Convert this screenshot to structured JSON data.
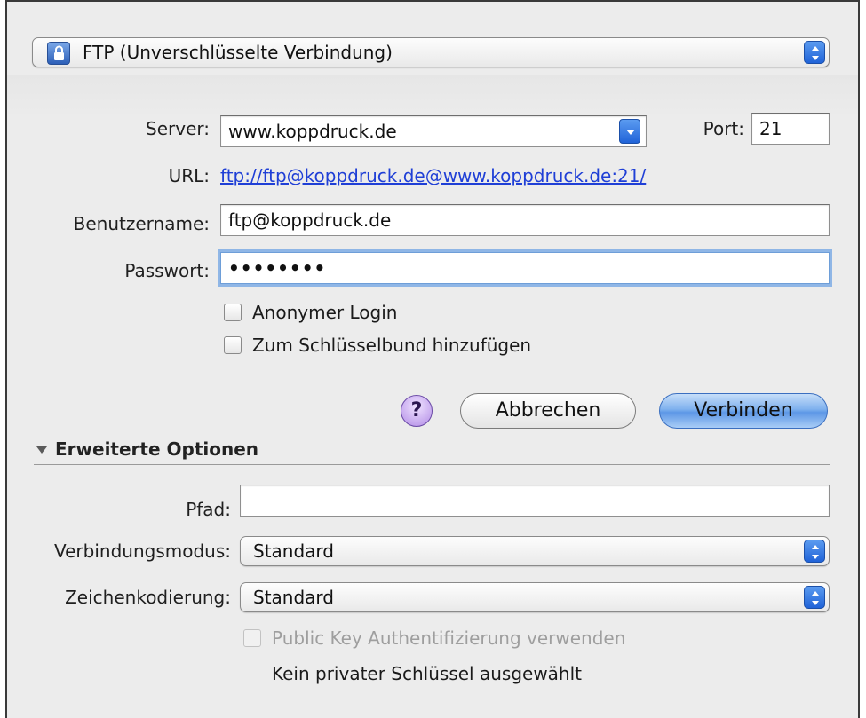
{
  "connection_type": {
    "value": "FTP (Unverschlüsselte Verbindung)",
    "icon": "lock-icon"
  },
  "server": {
    "label": "Server:",
    "value": "www.koppdruck.de"
  },
  "port": {
    "label": "Port:",
    "value": "21"
  },
  "url": {
    "label": "URL:",
    "value": "ftp://ftp@koppdruck.de@www.koppdruck.de:21/"
  },
  "username": {
    "label": "Benutzername:",
    "value": "ftp@koppdruck.de"
  },
  "password": {
    "label": "Passwort:",
    "value": "••••••••"
  },
  "checkboxes": {
    "anonymous": "Anonymer Login",
    "keychain": "Zum Schlüsselbund hinzufügen"
  },
  "buttons": {
    "help": "?",
    "cancel": "Abbrechen",
    "connect": "Verbinden"
  },
  "advanced": {
    "title": "Erweiterte Optionen",
    "path_label": "Pfad:",
    "path_value": "",
    "mode_label": "Verbindungsmodus:",
    "mode_value": "Standard",
    "encoding_label": "Zeichenkodierung:",
    "encoding_value": "Standard",
    "pubkey_label": "Public Key Authentifizierung verwenden",
    "no_key_text": "Kein privater Schlüssel ausgewählt"
  },
  "colors": {
    "accent": "#2063d8",
    "link": "#1f3fd6",
    "focus_ring": "#8fb6e6"
  }
}
